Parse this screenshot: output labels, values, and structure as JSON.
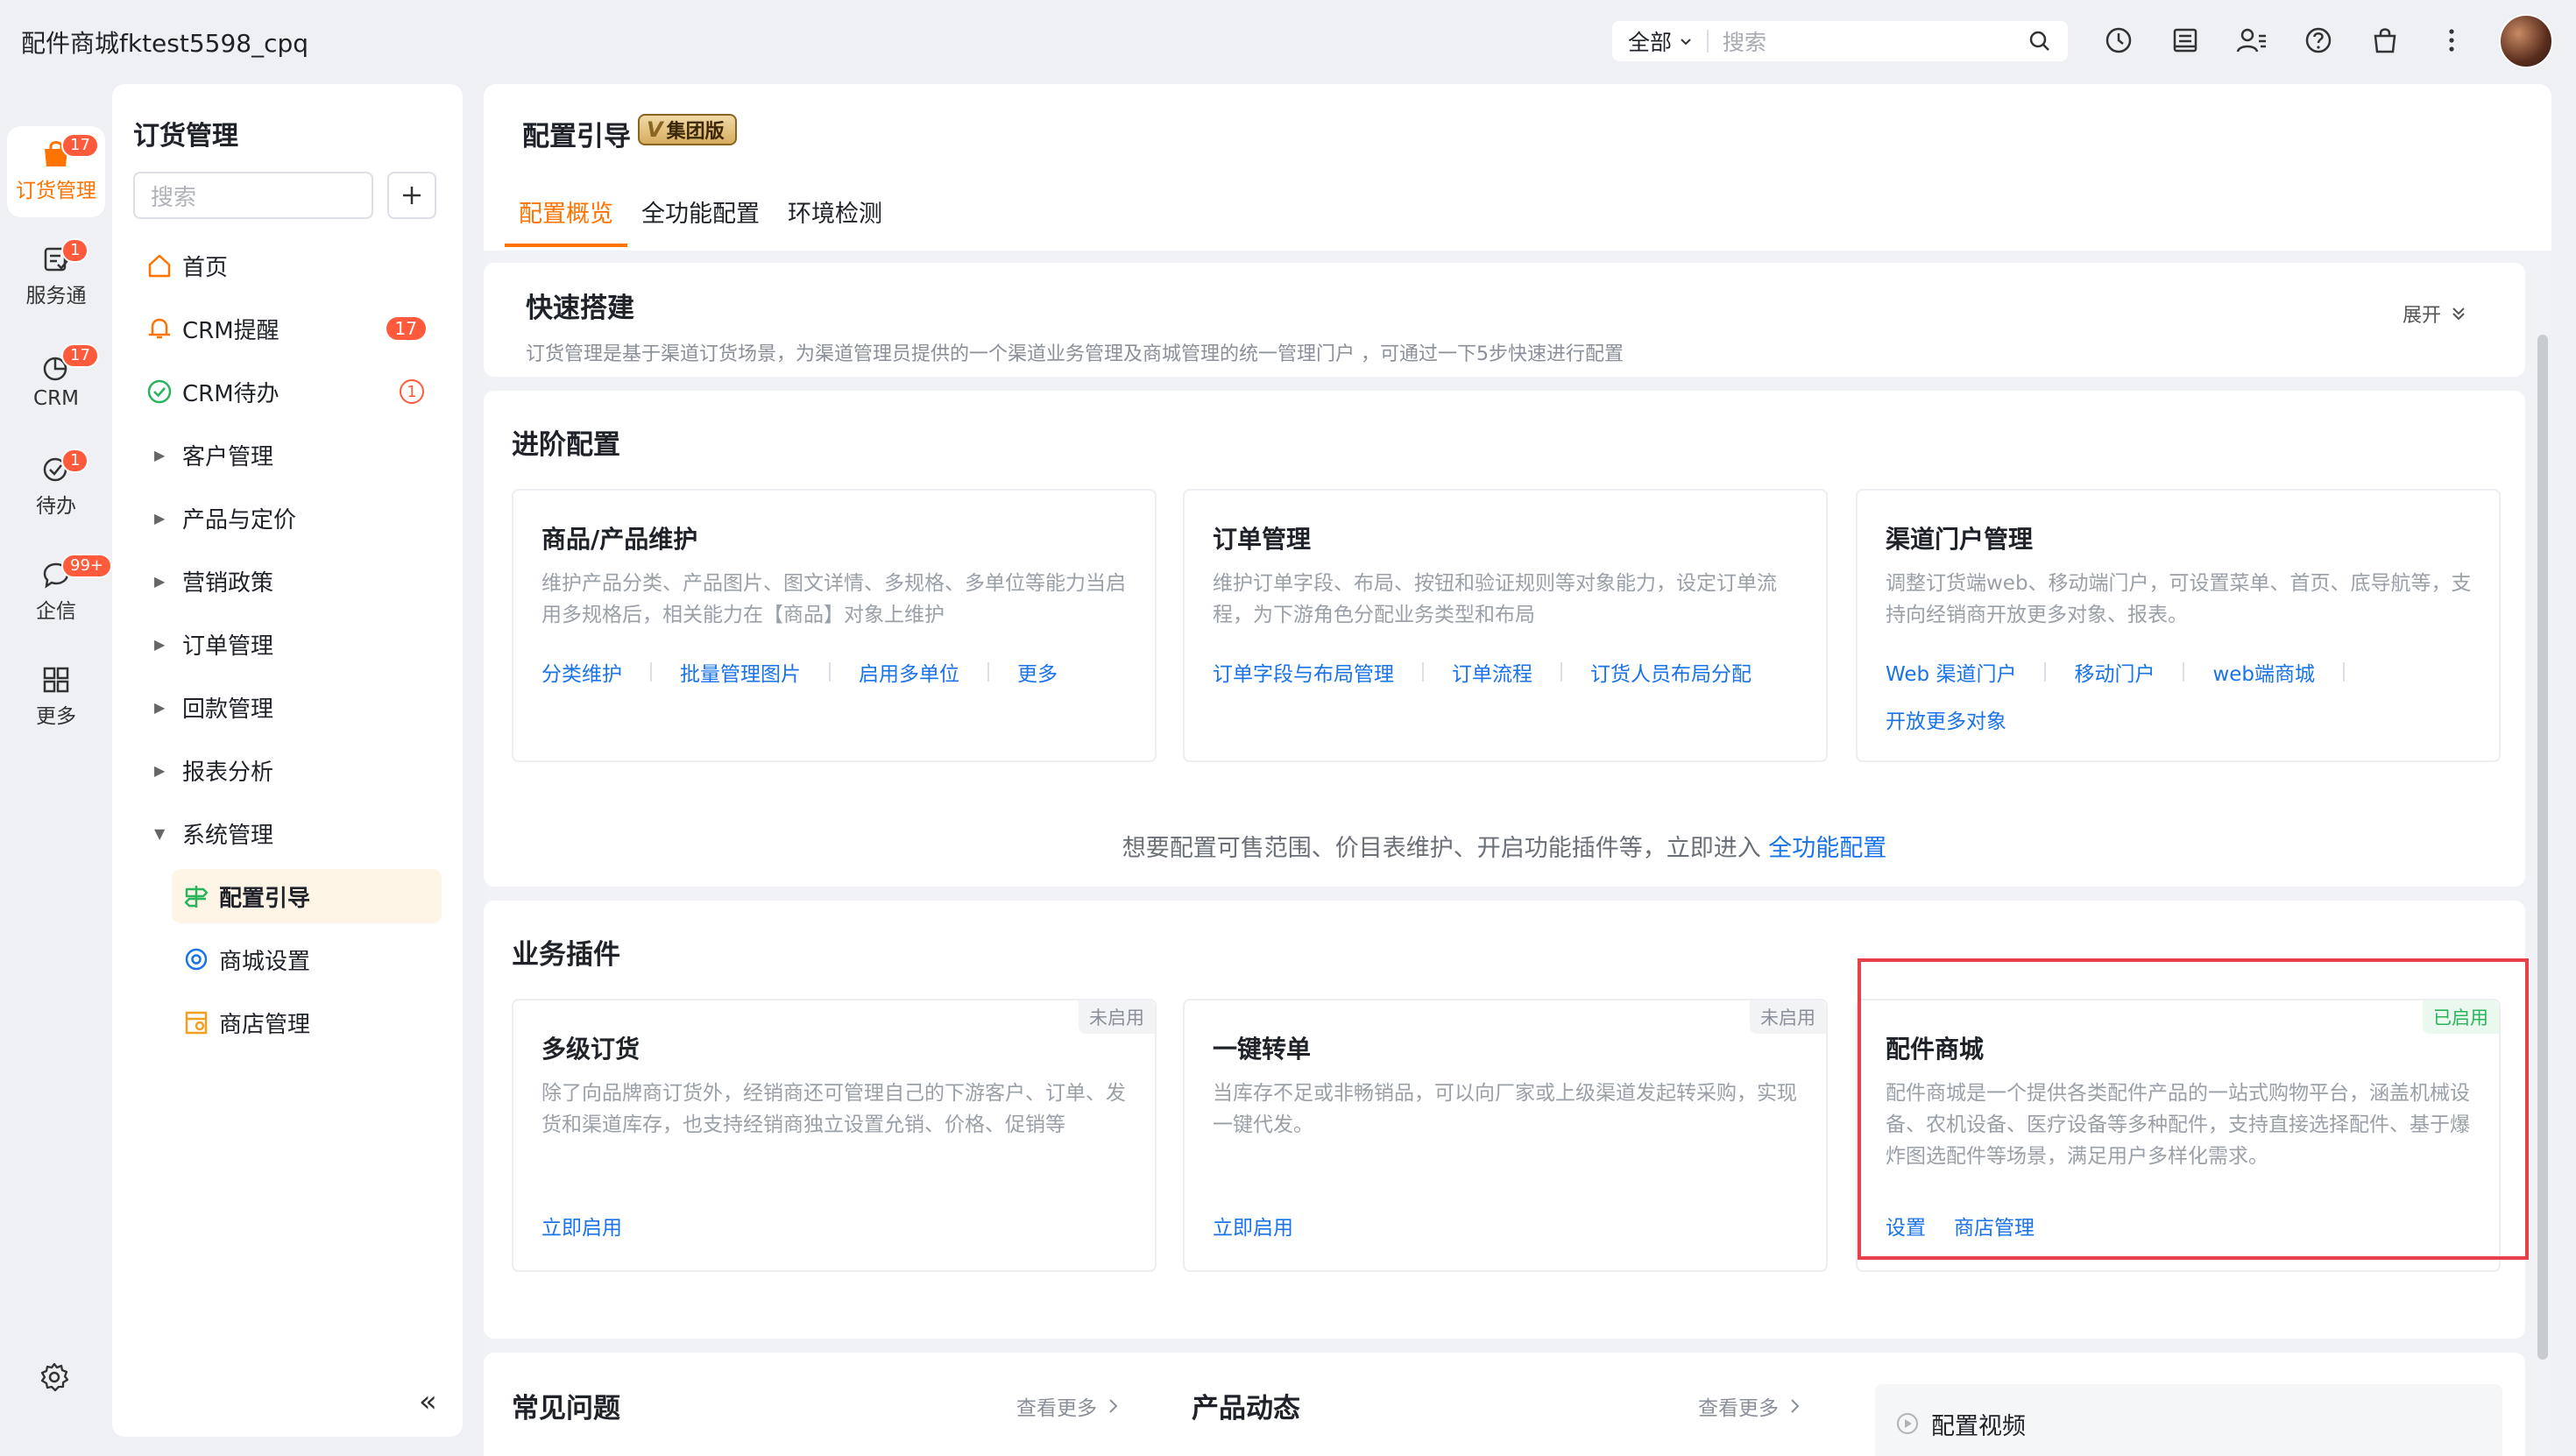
{
  "topbar": {
    "title": "配件商城fktest5598_cpq",
    "search_scope": "全部",
    "search_placeholder": "搜索",
    "icons": [
      "clock-icon",
      "notes-icon",
      "contacts-icon",
      "help-icon",
      "bag-icon",
      "more-vertical-icon"
    ]
  },
  "rail": {
    "items": [
      {
        "label": "订货管理",
        "badge": "17",
        "icon": "bag-icon"
      },
      {
        "label": "服务通",
        "badge": "1",
        "icon": "service-icon"
      },
      {
        "label": "CRM",
        "badge": "17",
        "icon": "crm-icon"
      },
      {
        "label": "待办",
        "badge": "1",
        "icon": "check-circle-icon"
      },
      {
        "label": "企信",
        "badge": "99+",
        "icon": "chat-icon"
      },
      {
        "label": "更多",
        "badge": "",
        "icon": "grid-icon"
      }
    ]
  },
  "sidebar": {
    "title": "订货管理",
    "search_placeholder": "搜索",
    "items": [
      {
        "label": "首页"
      },
      {
        "label": "CRM提醒",
        "badge": "17"
      },
      {
        "label": "CRM待办",
        "badge": "1"
      },
      {
        "label": "客户管理"
      },
      {
        "label": "产品与定价"
      },
      {
        "label": "营销政策"
      },
      {
        "label": "订单管理"
      },
      {
        "label": "回款管理"
      },
      {
        "label": "报表分析"
      },
      {
        "label": "系统管理"
      },
      {
        "label": "配置引导"
      },
      {
        "label": "商城设置"
      },
      {
        "label": "商店管理"
      }
    ]
  },
  "main": {
    "title": "配置引导",
    "edition_badge": "集团版",
    "tabs": [
      "配置概览",
      "全功能配置",
      "环境检测"
    ],
    "quick_setup": {
      "title": "快速搭建",
      "desc": "订货管理是基于渠道订货场景，为渠道管理员提供的一个渠道业务管理及商城管理的统一管理门户 ，可通过一下5步快速进行配置",
      "expand": "展开"
    },
    "advanced": {
      "title": "进阶配置",
      "cards": [
        {
          "title": "商品/产品维护",
          "desc": "维护产品分类、产品图片、图文详情、多规格、多单位等能力当启用多规格后，相关能力在【商品】对象上维护",
          "links": [
            "分类维护",
            "批量管理图片",
            "启用多单位",
            "更多"
          ]
        },
        {
          "title": "订单管理",
          "desc": "维护订单字段、布局、按钮和验证规则等对象能力，设定订单流程，为下游角色分配业务类型和布局",
          "links": [
            "订单字段与布局管理",
            "订单流程",
            "订货人员布局分配"
          ]
        },
        {
          "title": "渠道门户管理",
          "desc": "调整订货端web、移动端门户，可设置菜单、首页、底导航等，支持向经销商开放更多对象、报表。",
          "links": [
            "Web 渠道门户",
            "移动门户",
            "web端商城",
            "开放更多对象"
          ]
        }
      ],
      "hint_text": "想要配置可售范围、价目表维护、开启功能插件等，立即进入",
      "hint_link": "全功能配置"
    },
    "plugins": {
      "title": "业务插件",
      "cards": [
        {
          "title": "多级订货",
          "status": "未启用",
          "desc": "除了向品牌商订货外，经销商还可管理自己的下游客户、订单、发货和渠道库存，也支持经销商独立设置允销、价格、促销等",
          "links": [
            "立即启用"
          ]
        },
        {
          "title": "一键转单",
          "status": "未启用",
          "desc": "当库存不足或非畅销品，可以向厂家或上级渠道发起转采购，实现一键代发。",
          "links": [
            "立即启用"
          ]
        },
        {
          "title": "配件商城",
          "status": "已启用",
          "desc": "配件商城是一个提供各类配件产品的一站式购物平台，涵盖机械设备、农机设备、医疗设备等多种配件，支持直接选择配件、基于爆炸图选配件等场景，满足用户多样化需求。",
          "links": [
            "设置",
            "商店管理"
          ]
        }
      ]
    },
    "bottom": {
      "faq_title": "常见问题",
      "faq_more": "查看更多",
      "news_title": "产品动态",
      "news_more": "查看更多",
      "video_label": "配置视频"
    }
  },
  "colors": {
    "accent": "#ff7300",
    "link": "#1a73e8",
    "badge": "#ff5a3c",
    "enabled": "#29b35a",
    "highlight_frame": "#e8404a"
  }
}
